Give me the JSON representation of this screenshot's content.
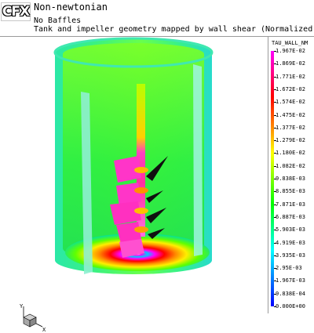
{
  "header": {
    "logo": "CFX",
    "title": "Non-newtonian",
    "subtitle1": "No Baffles",
    "subtitle2": "Tank and impeller geometry mapped by wall shear (Normalized)"
  },
  "legend": {
    "title": "TAU_WALL_NM",
    "values": [
      "1.967E-02",
      "1.869E-02",
      "1.771E-02",
      "1.672E-02",
      "1.574E-02",
      "1.475E-02",
      "1.377E-02",
      "1.279E-02",
      "1.180E-02",
      "1.082E-02",
      "9.838E-03",
      "8.855E-03",
      "7.871E-03",
      "6.887E-03",
      "5.903E-03",
      "4.919E-03",
      "3.935E-03",
      "2.95E-03",
      "1.967E-03",
      "9.838E-04",
      "0.000E+00"
    ],
    "colors": {
      "max": "#ff00ff",
      "high": "#ff0000",
      "mid_high": "#ffff00",
      "mid": "#00ff00",
      "mid_low": "#00ffff",
      "min": "#0000ff"
    }
  },
  "axes": {
    "y_label": "Y",
    "x_label": "X"
  }
}
